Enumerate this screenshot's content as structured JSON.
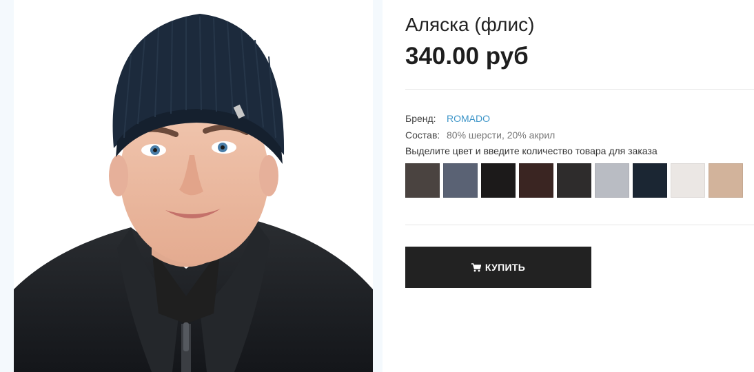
{
  "product": {
    "title": "Аляска (флис)",
    "price": "340.00 руб"
  },
  "specs": {
    "brand_label": "Бренд:",
    "brand_value": "ROMADO",
    "composition_label": "Состав:",
    "composition_value": "80% шерсти, 20% акрил"
  },
  "color_hint": "Выделите цвет и введите количество товара для заказа",
  "swatches": [
    {
      "color": "#4a4340"
    },
    {
      "color": "#5a6274"
    },
    {
      "color": "#1c1a1a"
    },
    {
      "color": "#3a2522"
    },
    {
      "color": "#2e2c2c"
    },
    {
      "color": "#b9bcc3"
    },
    {
      "color": "#1b2633"
    },
    {
      "color": "#ebe7e4"
    },
    {
      "color": "#d2b39b"
    }
  ],
  "buy_button": {
    "label": "КУПИТЬ",
    "icon": "shopping-cart-icon"
  },
  "image": {
    "icon": "product-photo"
  }
}
